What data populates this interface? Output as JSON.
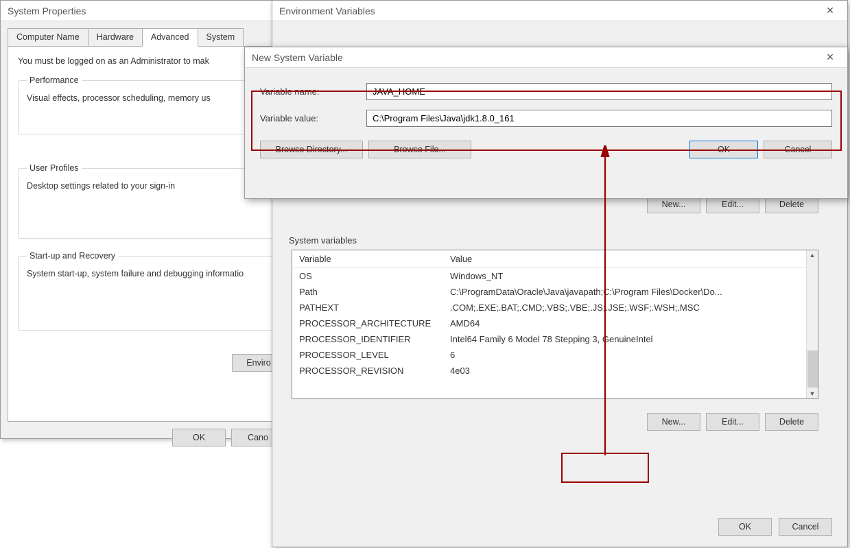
{
  "sysprops": {
    "title": "System Properties",
    "tabs": [
      "Computer Name",
      "Hardware",
      "Advanced",
      "System"
    ],
    "active_tab": 2,
    "admin_note": "You must be logged on as an Administrator to mak",
    "groups": {
      "performance": {
        "legend": "Performance",
        "desc": "Visual effects, processor scheduling, memory us"
      },
      "userprofiles": {
        "legend": "User Profiles",
        "desc": "Desktop settings related to your sign-in"
      },
      "startup": {
        "legend": "Start-up and Recovery",
        "desc": "System start-up, system failure and debugging informatio"
      }
    },
    "buttons": {
      "environment": "Enviro",
      "ok": "OK",
      "cancel": "Cano"
    }
  },
  "envvars": {
    "title": "Environment Variables",
    "section_system": "System variables",
    "cols": {
      "variable": "Variable",
      "value": "Value"
    },
    "rows": [
      {
        "name": "OS",
        "value": "Windows_NT"
      },
      {
        "name": "Path",
        "value": "C:\\ProgramData\\Oracle\\Java\\javapath;C:\\Program Files\\Docker\\Do..."
      },
      {
        "name": "PATHEXT",
        "value": ".COM;.EXE;.BAT;.CMD;.VBS;.VBE;.JS;.JSE;.WSF;.WSH;.MSC"
      },
      {
        "name": "PROCESSOR_ARCHITECTURE",
        "value": "AMD64"
      },
      {
        "name": "PROCESSOR_IDENTIFIER",
        "value": "Intel64 Family 6 Model 78 Stepping 3, GenuineIntel"
      },
      {
        "name": "PROCESSOR_LEVEL",
        "value": "6"
      },
      {
        "name": "PROCESSOR_REVISION",
        "value": "4e03"
      }
    ],
    "upper_buttons": {
      "new": "New...",
      "edit": "Edit...",
      "delete": "Delete"
    },
    "lower_buttons": {
      "new": "New...",
      "edit": "Edit...",
      "delete": "Delete"
    },
    "dialog_buttons": {
      "ok": "OK",
      "cancel": "Cancel"
    }
  },
  "nsv": {
    "title": "New System Variable",
    "labels": {
      "name": "Variable name:",
      "value": "Variable value:"
    },
    "inputs": {
      "name": "JAVA_HOME",
      "value": "C:\\Program Files\\Java\\jdk1.8.0_161"
    },
    "buttons": {
      "browse_dir": "Browse Directory...",
      "browse_file": "Browse File...",
      "ok": "OK",
      "cancel": "Cancel"
    }
  }
}
